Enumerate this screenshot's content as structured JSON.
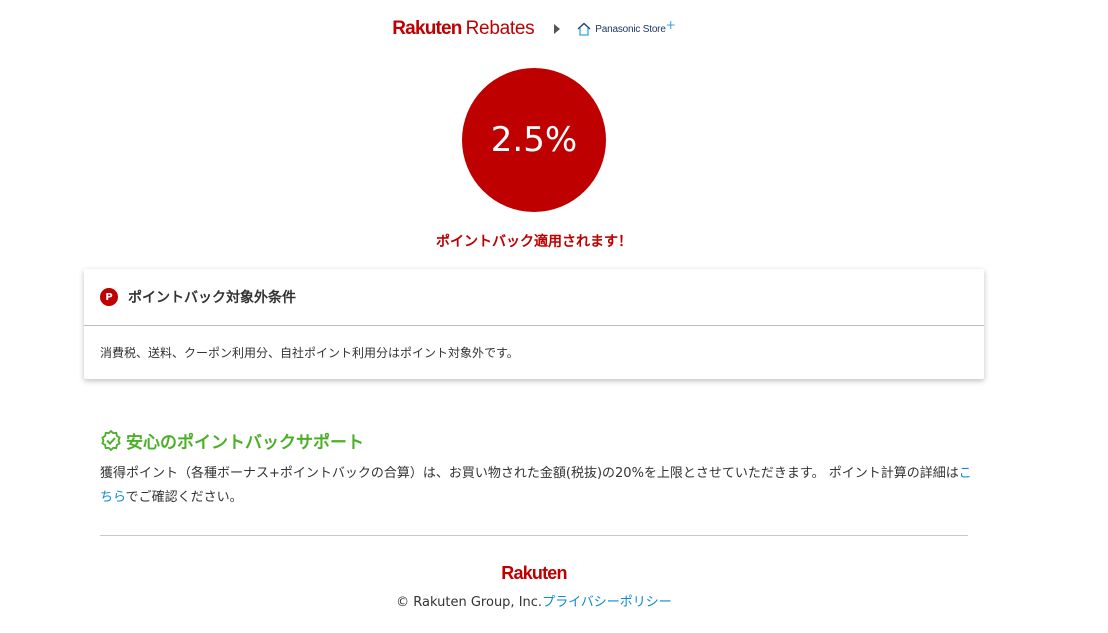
{
  "header": {
    "logo_rakuten": "Rakuten",
    "logo_rebates": "Rebates",
    "store_name": "Panasonic Store",
    "store_plus": "+"
  },
  "rate": {
    "value": "2.5%",
    "applied_text": "ポイントバック適用されます！"
  },
  "conditions": {
    "icon_letter": "P",
    "title": "ポイントバック対象外条件",
    "body": "消費税、送料、クーポン利用分、自社ポイント利用分はポイント対象外です。"
  },
  "support": {
    "title": "安心のポイントバックサポート",
    "text_before_link": "獲得ポイント（各種ボーナス+ポイントバックの合算）は、お買い物された金額(税抜)の20%を上限とさせていただきます。 ポイント計算の詳細は",
    "link_text": "こちら",
    "text_after_link": "でご確認ください。"
  },
  "footer": {
    "logo": "Rakuten",
    "copyright": "© Rakuten Group, Inc.",
    "privacy_link": "プライバシーポリシー"
  },
  "colors": {
    "brand_red": "#bf0000",
    "support_green": "#4bb027",
    "link_blue": "#0a8ad3"
  },
  "icons": {
    "separator": "chevron-right-icon",
    "store": "house-icon",
    "points": "point-p-icon",
    "support": "check-badge-icon"
  }
}
